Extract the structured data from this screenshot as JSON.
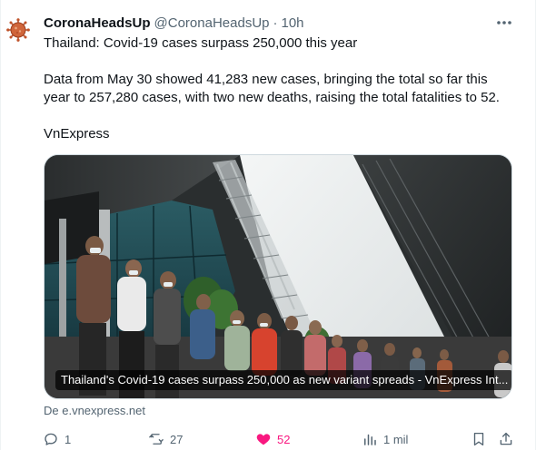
{
  "tweet": {
    "author_name": "CoronaHeadsUp",
    "author_handle": "@CoronaHeadsUp",
    "separator": "·",
    "time": "10h",
    "headline": "Thailand: Covid-19 cases surpass 250,000 this year",
    "body_line1": "Data from May 30 showed 41,283 new cases, bringing the total so far this",
    "body_line2": "year to 257,280 cases, with two new deaths, raising the total fatalities to 52.",
    "source_name": "VnExpress",
    "card_title": "Thailand's Covid-19 cases surpass 250,000 as new variant spreads - VnExpress Int...",
    "card_source": "De e.vnexpress.net"
  },
  "actions": {
    "replies": "1",
    "retweets": "27",
    "likes": "52",
    "views": "1 mil"
  },
  "icons": [
    "virus-avatar-icon",
    "more-icon",
    "reply-icon",
    "retweet-icon",
    "heart-icon",
    "views-icon",
    "share-icon"
  ],
  "colors": {
    "like": "#f91880",
    "secondary": "#536471",
    "text": "#0f1419"
  }
}
